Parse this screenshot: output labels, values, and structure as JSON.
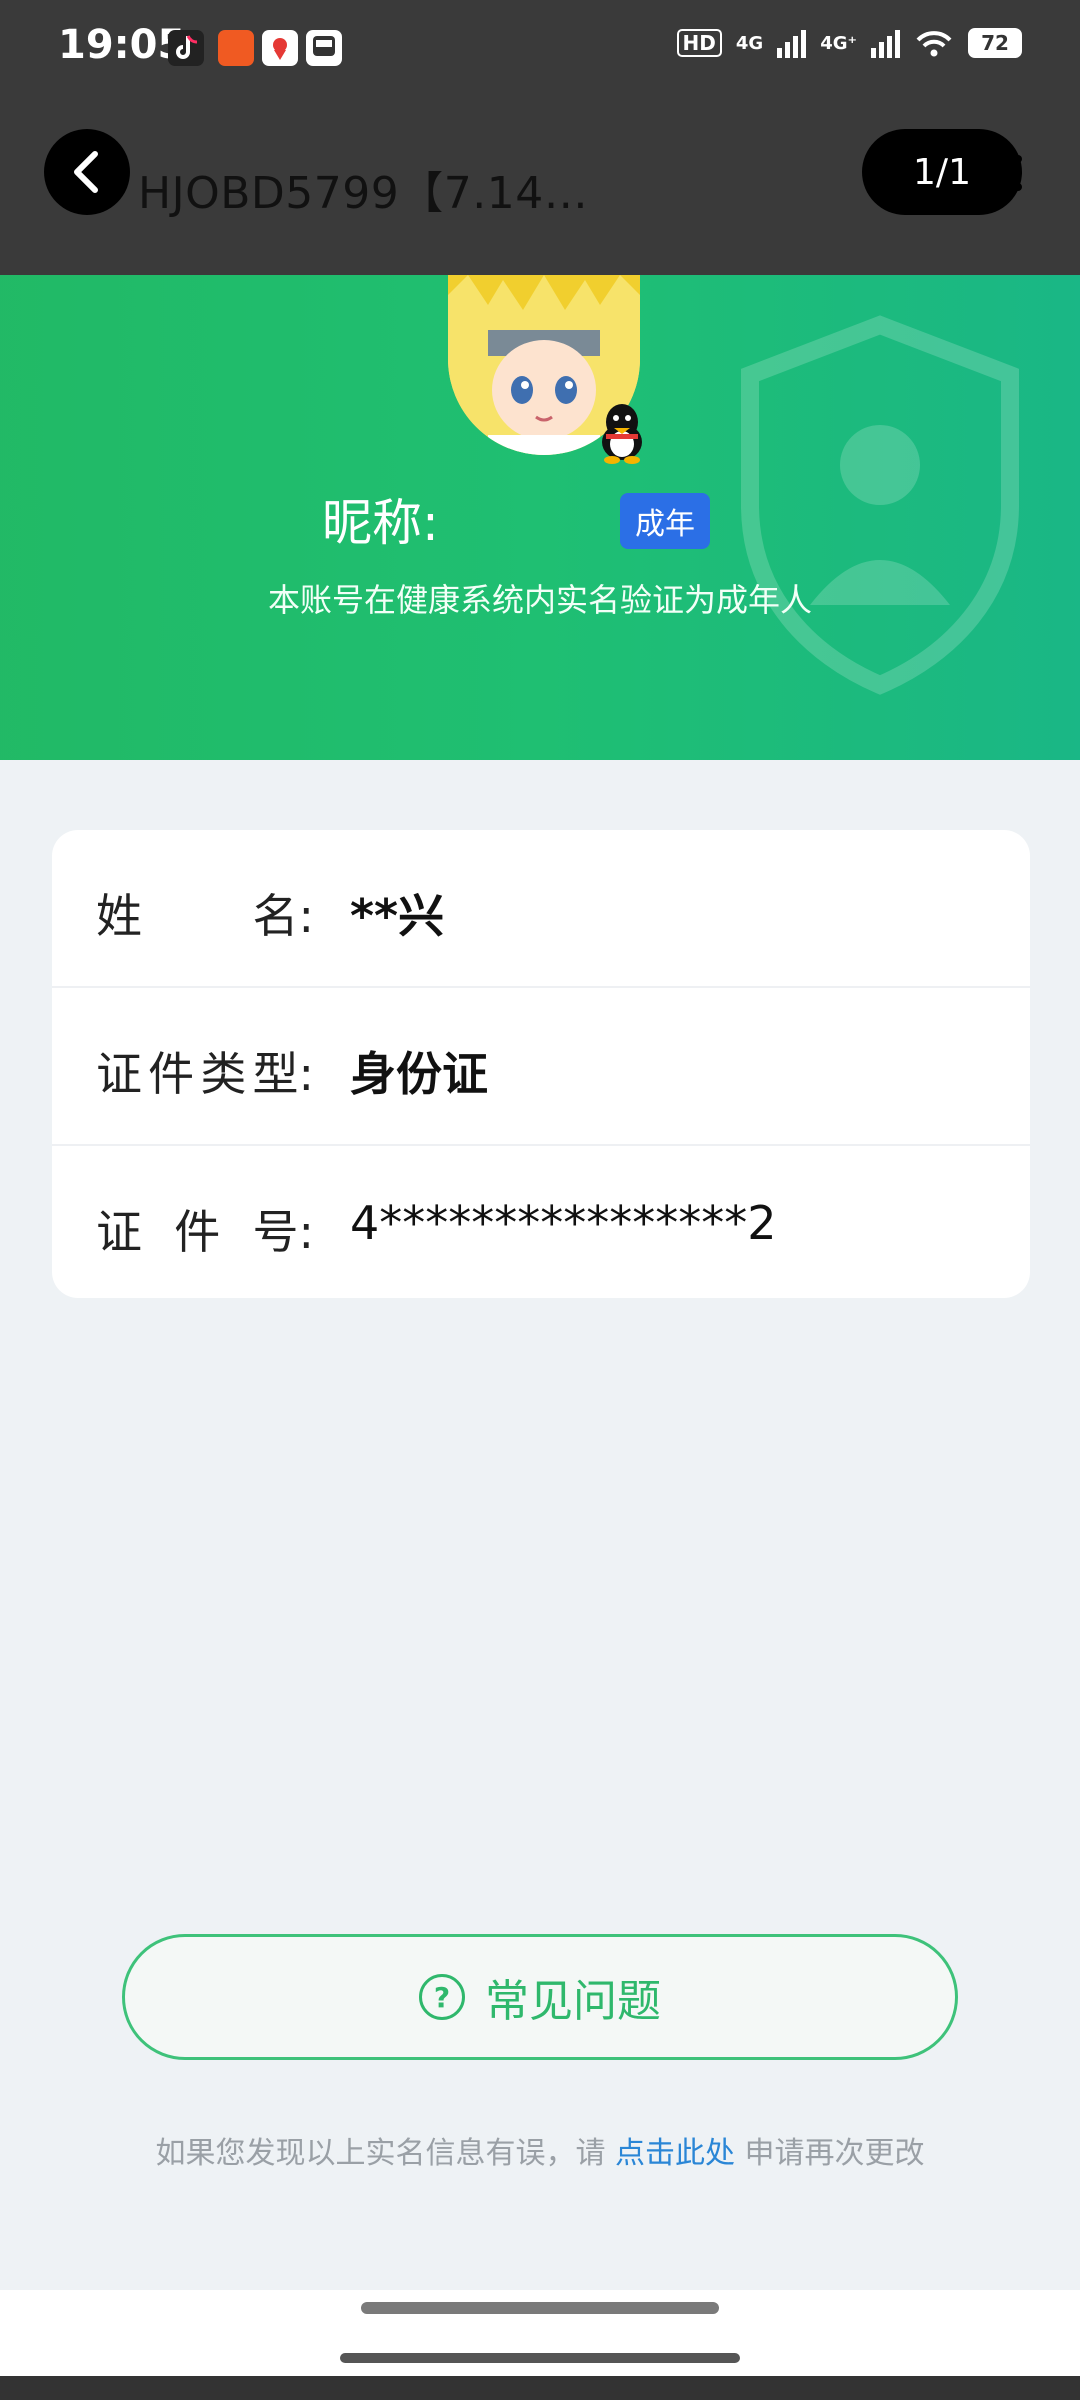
{
  "status_bar": {
    "time": "19:05",
    "hd_badge": "HD",
    "net1": "4G",
    "net2": "4G⁺",
    "battery": "72"
  },
  "navbar": {
    "title": "HJOBD5799【7.14…",
    "pager": "1/1"
  },
  "profile": {
    "nickname_label": "昵称:",
    "badge": "成年",
    "subtitle": "本账号在健康系统内实名验证为成年人"
  },
  "info": {
    "rows": [
      {
        "label": [
          "姓",
          "名:"
        ],
        "value": "**兴"
      },
      {
        "label": [
          "证",
          "件",
          "类",
          "型:"
        ],
        "value": "身份证"
      },
      {
        "label": [
          "证",
          "件",
          "号:"
        ],
        "value": "4****************2"
      }
    ]
  },
  "faq": {
    "icon": "?",
    "label": "常见问题"
  },
  "note": {
    "prefix": "如果您发现以上实名信息有误，请 ",
    "link": "点击此处",
    "suffix": " 申请再次更改"
  },
  "colors": {
    "green": "#22b863",
    "badge_blue": "#2b6fe6",
    "link_blue": "#2a86d6"
  }
}
